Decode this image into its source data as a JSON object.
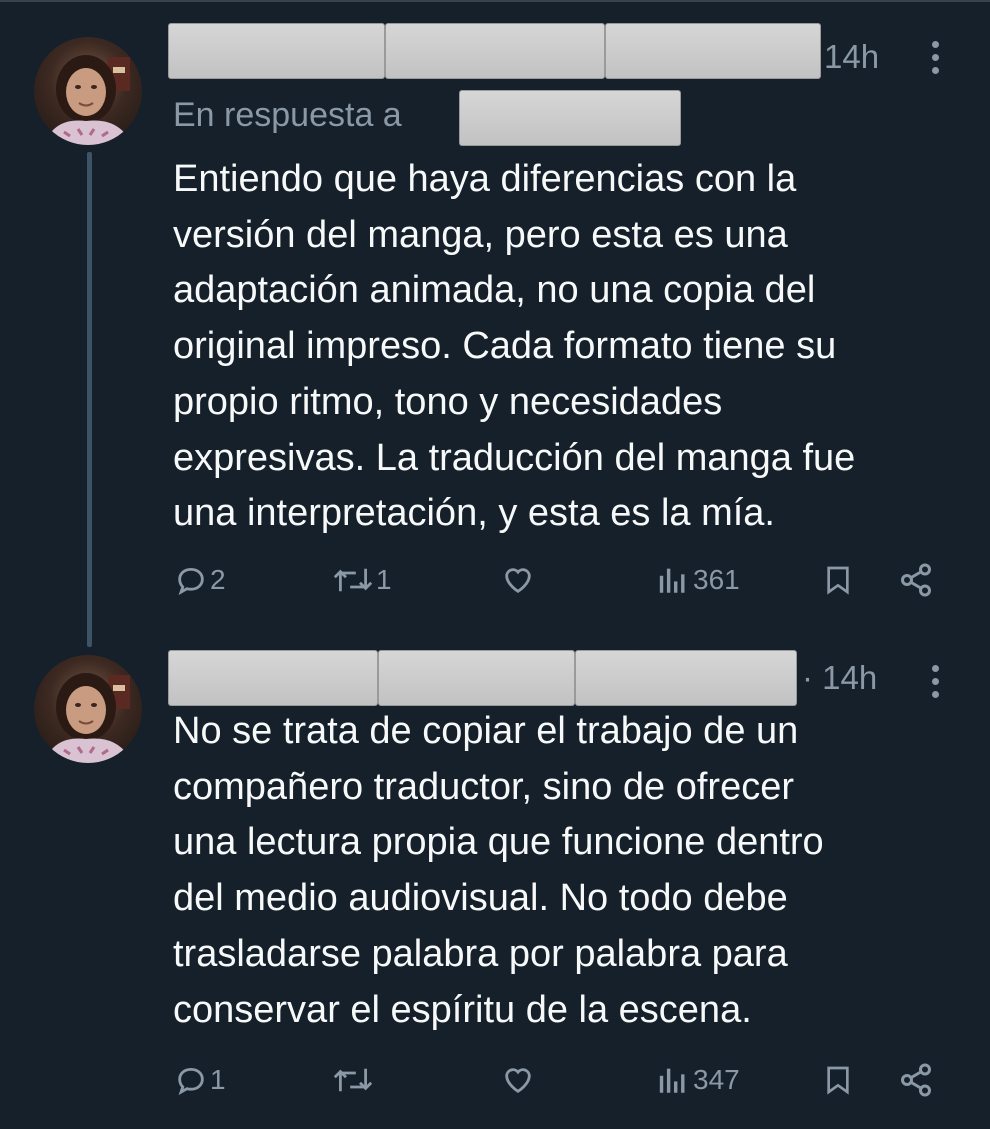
{
  "tweets": [
    {
      "time": "14h",
      "reply_prefix": "En respuesta a",
      "text": "Entiendo que haya diferencias con la\nversión del manga, pero esta es una\nadaptación animada, no una copia del\noriginal impreso. Cada formato tiene su\npropio ritmo, tono y necesidades\nexpresivas. La traducción del manga fue\nuna interpretación, y esta es la mía.",
      "replies": "2",
      "reposts": "1",
      "views": "361"
    },
    {
      "time": "· 14h",
      "text": "No se trata de copiar el trabajo de un\ncompañero traductor, sino de ofrecer\nuna lectura propia que funcione dentro\ndel medio audiovisual. No todo debe\ntrasladarse palabra por palabra para\nconservar el espíritu de la escena.",
      "replies": "1",
      "reposts": "",
      "views": "347"
    }
  ],
  "icons": {
    "reply": "reply-icon",
    "repost": "repost-icon",
    "like": "like-icon",
    "views": "views-icon",
    "bookmark": "bookmark-icon",
    "share": "share-icon",
    "more": "more-icon"
  },
  "colors": {
    "background": "#15202b",
    "text": "#f7f9f9",
    "secondary": "#8b98a5",
    "thread_line": "#3d5466",
    "redaction": "#c8c8c8"
  }
}
